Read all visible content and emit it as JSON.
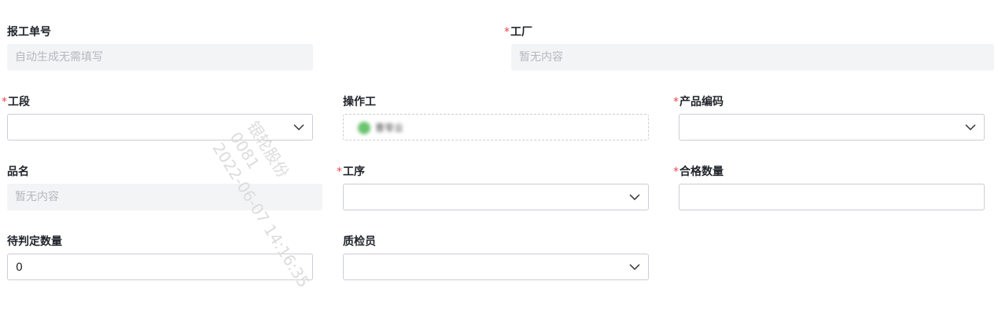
{
  "form": {
    "report_no": {
      "label": "报工单号",
      "placeholder": "自动生成无需填写"
    },
    "factory": {
      "required": "*",
      "label": "工厂",
      "placeholder": "暂无内容"
    },
    "section": {
      "required": "*",
      "label": "工段",
      "value": ""
    },
    "operator": {
      "label": "操作工",
      "chip_name": "曹零业"
    },
    "product_code": {
      "required": "*",
      "label": "产品编码",
      "value": ""
    },
    "product_name": {
      "label": "品名",
      "placeholder": "暂无内容"
    },
    "process": {
      "required": "*",
      "label": "工序",
      "value": ""
    },
    "qualified_qty": {
      "required": "*",
      "label": "合格数量",
      "value": ""
    },
    "pending_qty": {
      "label": "待判定数量",
      "value": "0"
    },
    "inspector": {
      "label": "质检员",
      "value": ""
    }
  },
  "watermark": {
    "line1": "银轮股份",
    "line2": "0081",
    "line3": "2022-06-07 14:16:35"
  },
  "icons": {
    "select_arrow": "chevron-down-icon",
    "avatar": "avatar-dot"
  }
}
